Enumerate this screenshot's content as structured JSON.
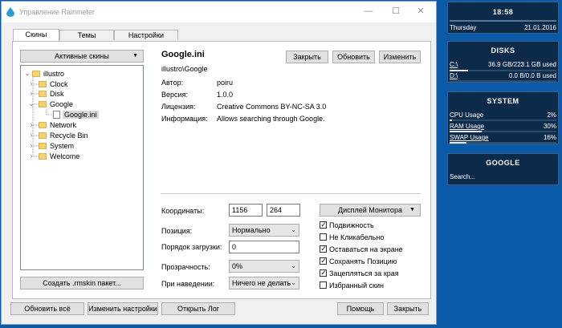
{
  "window": {
    "title": "Управление Rainmeter",
    "tabs": [
      "Скины",
      "Темы",
      "Настройки"
    ]
  },
  "left_panel": {
    "active_skins_label": "Активные скины",
    "tree": [
      "illustro",
      "Clock",
      "Disk",
      "Google",
      "Google.ini",
      "Network",
      "Recycle Bin",
      "System",
      "Welcome"
    ],
    "create_button": "Создать .rmskin пакет..."
  },
  "skin": {
    "name": "Google.ini",
    "path": "illustro\\Google",
    "buttons": {
      "close": "Закрыть",
      "refresh": "Обновить",
      "edit": "Изменить"
    },
    "info": [
      {
        "key": "Автор:",
        "value": "poiru"
      },
      {
        "key": "Версия:",
        "value": "1.0.0"
      },
      {
        "key": "Лицензия:",
        "value": "Creative Commons BY-NC-SA 3.0"
      },
      {
        "key": "Информация:",
        "value": "Allows searching through Google."
      }
    ]
  },
  "settings": {
    "coords_label": "Координаты:",
    "x": "1156",
    "y": "264",
    "position_label": "Позиция:",
    "position_value": "Нормально",
    "load_order_label": "Порядок загрузки:",
    "load_order_value": "0",
    "transparency_label": "Прозрачность:",
    "transparency_value": "0%",
    "hover_label": "При наведении:",
    "hover_value": "Ничего не делать",
    "monitor_button": "Дисплей Монитора",
    "checkboxes": [
      {
        "label": "Подвижность",
        "checked": true
      },
      {
        "label": "Не Кликабельно",
        "checked": false
      },
      {
        "label": "Оставаться на экране",
        "checked": true
      },
      {
        "label": "Сохранять Позицию",
        "checked": true
      },
      {
        "label": "Зацепляться за края",
        "checked": true
      },
      {
        "label": "Избранный скин",
        "checked": false
      }
    ]
  },
  "footer": {
    "refresh_all": "Обновить всё",
    "edit_settings": "Изменить настройки",
    "open_log": "Открыть Лог",
    "help": "Помощь",
    "close": "Закрыть"
  },
  "widgets": {
    "clock": {
      "time": "18:58",
      "day": "Thursday",
      "date": "21.01.2016"
    },
    "disks": {
      "title": "DISKS",
      "rows": [
        {
          "label": "C:\\",
          "value": "36.9 GB/223.1 GB used",
          "fill": 0.17
        },
        {
          "label": "D:\\",
          "value": "0.0 B/0.0 B used",
          "fill": 0
        }
      ]
    },
    "system": {
      "title": "SYSTEM",
      "rows": [
        {
          "label": "CPU Usage",
          "value": "2%",
          "fill": 0.02
        },
        {
          "label": "RAM Usage",
          "value": "30%",
          "fill": 0.3
        },
        {
          "label": "SWAP Usage",
          "value": "16%",
          "fill": 0.16
        }
      ]
    },
    "google": {
      "title": "GOOGLE",
      "placeholder": "Search..."
    }
  },
  "colors": {
    "desktop": "#0a5aa8",
    "widget_bg": "#0c2a4a"
  }
}
